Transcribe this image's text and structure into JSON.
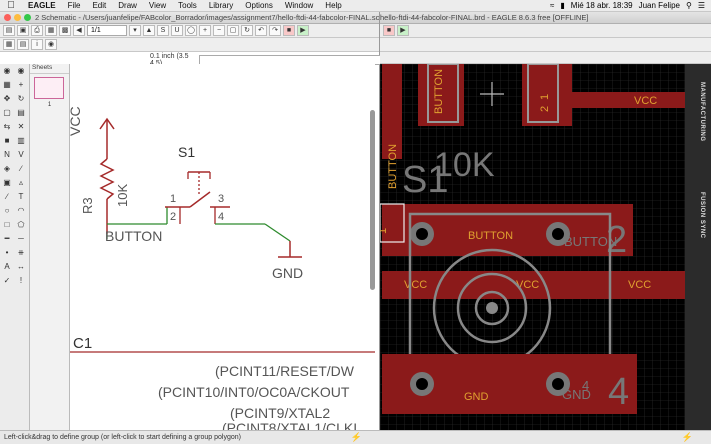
{
  "menubar": {
    "app": "EAGLE",
    "items": [
      "File",
      "Edit",
      "Draw",
      "View",
      "Tools",
      "Library",
      "Options",
      "Window",
      "Help"
    ],
    "clock": "Mié 18 abr.  18:39",
    "user": "Juan Felipe"
  },
  "schematic": {
    "title": "2 Schematic - /Users/juanfelipe/FABcolor_Borrador/images/assignment7/hello-ftdi-44-fabcolor-FINAL.sch - EA...",
    "sheet_value": "1/1",
    "coord": "0.1 inch (3.5 4.5)",
    "sheets_label": "Sheets",
    "sheet_num": "1",
    "status": "Left-click&drag to define group (or left-click to start defining a group polygon)",
    "labels": {
      "vcc": "VCC",
      "r3": "R3",
      "r3_val": "10K",
      "s1": "S1",
      "pin1": "1",
      "pin2": "2",
      "pin3": "3",
      "pin4": "4",
      "button": "BUTTON",
      "gnd": "GND",
      "c1": "C1",
      "pc1": "(PCINT11/RESET/DW",
      "pc2": "(PCINT10/INT0/OC0A/CKOUT",
      "pc3": "(PCINT9/XTAL2",
      "pc4": "(PCINT8/XTAL1/CLKI"
    }
  },
  "board": {
    "title": "hello-ftdi-44-fabcolor-FINAL.brd - EAGLE 8.6.3 free [OFFLINE]",
    "sidetabs": [
      "MANUFACTURING",
      "FUSION SYNC"
    ],
    "labels": {
      "button_top": "BUTTON",
      "vcc1": "VCC",
      "s1": "S1",
      "r10k": "10K",
      "button2": "BUTTON",
      "button3": "BUTTON",
      "vcc2": "VCC",
      "vcc3": "VCC",
      "vcc4": "VCC",
      "gnd": "GND",
      "gnd2": "GND",
      "n1": "1",
      "n2": "2",
      "n4": "4",
      "n4b": "4",
      "n2top": "2",
      "n1top": "1"
    }
  }
}
